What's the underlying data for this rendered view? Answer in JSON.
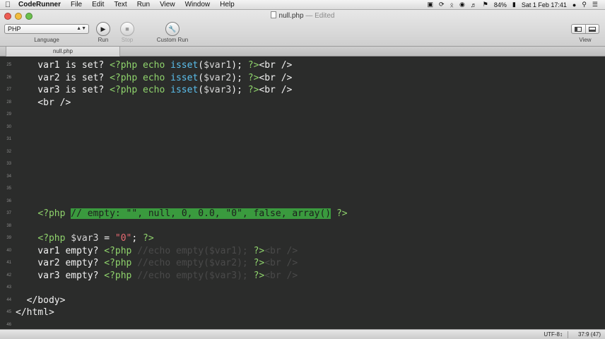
{
  "menubar": {
    "apple_glyph": "",
    "app_name": "CodeRunner",
    "items": [
      "File",
      "Edit",
      "Text",
      "Run",
      "View",
      "Window",
      "Help"
    ],
    "battery": "84%",
    "datetime": "Sat 1 Feb  17:41"
  },
  "window": {
    "title": "null.php",
    "title_suffix": " — Edited"
  },
  "toolbar": {
    "language_value": "PHP",
    "language_label": "Language",
    "run_label": "Run",
    "stop_label": "Stop",
    "custom_run_label": "Custom Run",
    "view_label": "View"
  },
  "tabs": [
    {
      "label": "null.php"
    }
  ],
  "editor": {
    "lines": [
      {
        "n": "25",
        "code": [
          {
            "t": "    var1 is set? ",
            "c": ""
          },
          {
            "t": "<?php echo ",
            "c": "php"
          },
          {
            "t": "isset",
            "c": "fn"
          },
          {
            "t": "(",
            "c": ""
          },
          {
            "t": "$var1",
            "c": "var"
          },
          {
            "t": "); ",
            "c": ""
          },
          {
            "t": "?>",
            "c": "php"
          },
          {
            "t": "<br />",
            "c": ""
          }
        ]
      },
      {
        "n": "26",
        "code": [
          {
            "t": "    var2 is set? ",
            "c": ""
          },
          {
            "t": "<?php echo ",
            "c": "php"
          },
          {
            "t": "isset",
            "c": "fn"
          },
          {
            "t": "(",
            "c": ""
          },
          {
            "t": "$var2",
            "c": "var"
          },
          {
            "t": "); ",
            "c": ""
          },
          {
            "t": "?>",
            "c": "php"
          },
          {
            "t": "<br />",
            "c": ""
          }
        ]
      },
      {
        "n": "27",
        "code": [
          {
            "t": "    var3 is set? ",
            "c": ""
          },
          {
            "t": "<?php echo ",
            "c": "php"
          },
          {
            "t": "isset",
            "c": "fn"
          },
          {
            "t": "(",
            "c": ""
          },
          {
            "t": "$var3",
            "c": "var"
          },
          {
            "t": "); ",
            "c": ""
          },
          {
            "t": "?>",
            "c": "php"
          },
          {
            "t": "<br />",
            "c": ""
          }
        ]
      },
      {
        "n": "28",
        "code": [
          {
            "t": "    <br />",
            "c": ""
          }
        ]
      },
      {
        "n": "29",
        "code": []
      },
      {
        "n": "30",
        "code": []
      },
      {
        "n": "31",
        "code": []
      },
      {
        "n": "32",
        "code": []
      },
      {
        "n": "33",
        "code": []
      },
      {
        "n": "34",
        "code": []
      },
      {
        "n": "35",
        "code": []
      },
      {
        "n": "36",
        "code": []
      },
      {
        "n": "37",
        "code": [
          {
            "t": "    ",
            "c": ""
          },
          {
            "t": "<?php ",
            "c": "php"
          },
          {
            "t": "// empty: \"\", null, 0, 0.0, \"0\", false, array()",
            "c": "cmtsel"
          },
          {
            "t": " ?>",
            "c": "php"
          }
        ]
      },
      {
        "n": "38",
        "code": []
      },
      {
        "n": "39",
        "code": [
          {
            "t": "    ",
            "c": ""
          },
          {
            "t": "<?php ",
            "c": "php"
          },
          {
            "t": "$var3",
            "c": "var"
          },
          {
            "t": " = ",
            "c": ""
          },
          {
            "t": "\"0\"",
            "c": "str"
          },
          {
            "t": "; ",
            "c": ""
          },
          {
            "t": "?>",
            "c": "php"
          }
        ]
      },
      {
        "n": "40",
        "code": [
          {
            "t": "    var1 empty? ",
            "c": ""
          },
          {
            "t": "<?php ",
            "c": "php"
          },
          {
            "t": "//echo empty($var1); ",
            "c": "cmt"
          },
          {
            "t": "?>",
            "c": "php"
          },
          {
            "t": "<br />",
            "c": "cmt"
          }
        ]
      },
      {
        "n": "41",
        "code": [
          {
            "t": "    var2 empty? ",
            "c": ""
          },
          {
            "t": "<?php ",
            "c": "php"
          },
          {
            "t": "//echo empty($var2); ",
            "c": "cmt"
          },
          {
            "t": "?>",
            "c": "php"
          },
          {
            "t": "<br />",
            "c": "cmt"
          }
        ]
      },
      {
        "n": "42",
        "code": [
          {
            "t": "    var3 empty? ",
            "c": ""
          },
          {
            "t": "<?php ",
            "c": "php"
          },
          {
            "t": "//echo empty($var3); ",
            "c": "cmt"
          },
          {
            "t": "?>",
            "c": "php"
          },
          {
            "t": "<br />",
            "c": "cmt"
          }
        ]
      },
      {
        "n": "43",
        "code": []
      },
      {
        "n": "44",
        "code": [
          {
            "t": "  </body>",
            "c": ""
          }
        ]
      },
      {
        "n": "45",
        "code": [
          {
            "t": "</html>",
            "c": ""
          }
        ]
      },
      {
        "n": "46",
        "code": []
      }
    ]
  },
  "statusbar": {
    "encoding": "UTF-8↕",
    "cursor_position": "37:9 (47)"
  },
  "colors": {
    "editor_bg": "#2b2c2b",
    "php_tag": "#8fd36c",
    "function": "#5bc0ee",
    "string": "#e86a72",
    "selection": "#3a9a3e"
  }
}
